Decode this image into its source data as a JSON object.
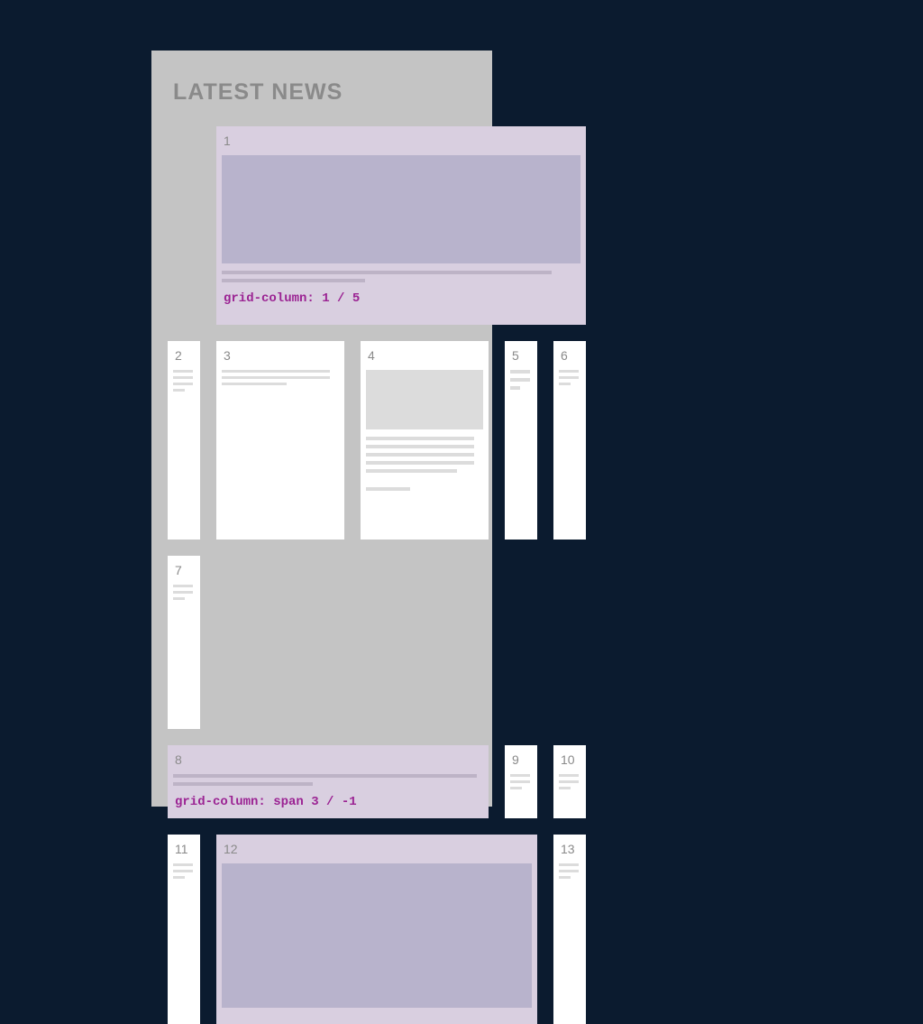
{
  "panel": {
    "title": "LATEST NEWS"
  },
  "cards": {
    "c1": {
      "num": "1",
      "code": "grid-column: 1 / 5"
    },
    "c2": {
      "num": "2"
    },
    "c3": {
      "num": "3"
    },
    "c4": {
      "num": "4"
    },
    "c5": {
      "num": "5"
    },
    "c6": {
      "num": "6"
    },
    "c7": {
      "num": "7"
    },
    "c8": {
      "num": "8",
      "code": "grid-column: span 3 / -1"
    },
    "c9": {
      "num": "9"
    },
    "c10": {
      "num": "10"
    },
    "c11": {
      "num": "11"
    },
    "c12": {
      "num": "12"
    },
    "c13": {
      "num": "13"
    }
  }
}
